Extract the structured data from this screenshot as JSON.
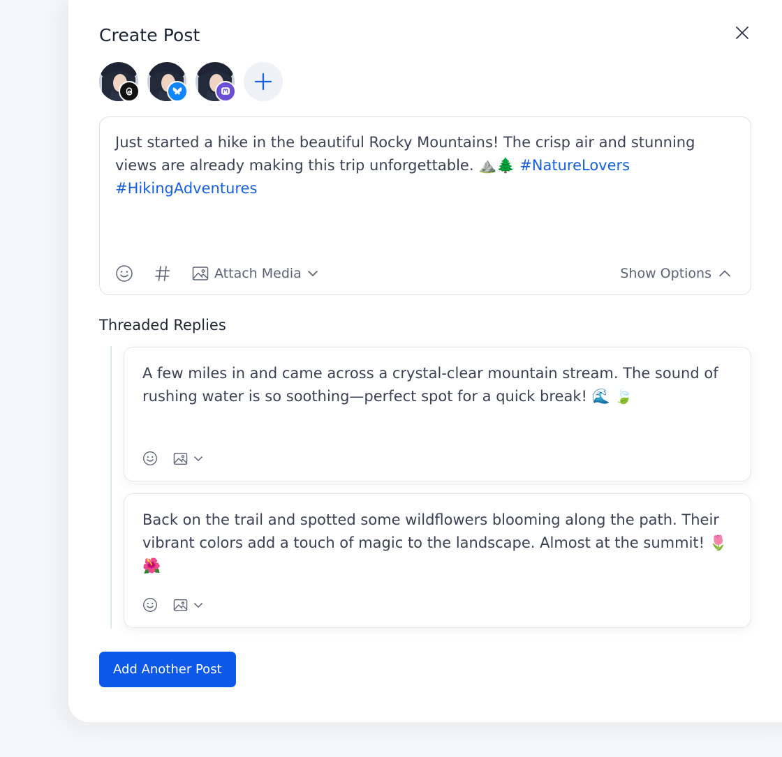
{
  "modal": {
    "title": "Create Post",
    "close_icon": "close-icon"
  },
  "accounts": [
    {
      "network": "threads",
      "badge_icon": "threads-logo-icon",
      "badge_color": "#111111"
    },
    {
      "network": "bluesky",
      "badge_icon": "bluesky-butterfly-icon",
      "badge_color": "#1185fe"
    },
    {
      "network": "mastodon",
      "badge_icon": "mastodon-logo-icon",
      "badge_color": "#6a4fd6"
    }
  ],
  "add_account_icon": "plus-icon",
  "composer": {
    "text": "Just started a hike in the beautiful Rocky Mountains! The crisp air and stunning views are already making this trip unforgettable. ⛰️🌲",
    "hashtag_1": "#NatureLovers",
    "hashtag_2": "#HikingAdventures",
    "toolbar": {
      "emoji_icon": "smiley-icon",
      "hashtag_icon": "hashtag-icon",
      "attach_media_label": "Attach Media",
      "attach_icon": "image-icon",
      "show_options_label": "Show Options"
    }
  },
  "threaded_replies": {
    "title": "Threaded Replies",
    "replies": [
      {
        "text": "A few miles in and came across a crystal-clear mountain stream. The sound of rushing water is so soothing—perfect spot for a quick break! 🌊 🍃"
      },
      {
        "text": "Back on the trail and spotted some wildflowers blooming along the path. Their vibrant colors add a touch of magic to the landscape. Almost at the summit! 🌷🌺"
      }
    ]
  },
  "add_post_button": "Add Another Post",
  "colors": {
    "accent": "#0b58e9",
    "hashtag": "#1660e0",
    "text": "#3a4154",
    "muted": "#5b6275"
  }
}
